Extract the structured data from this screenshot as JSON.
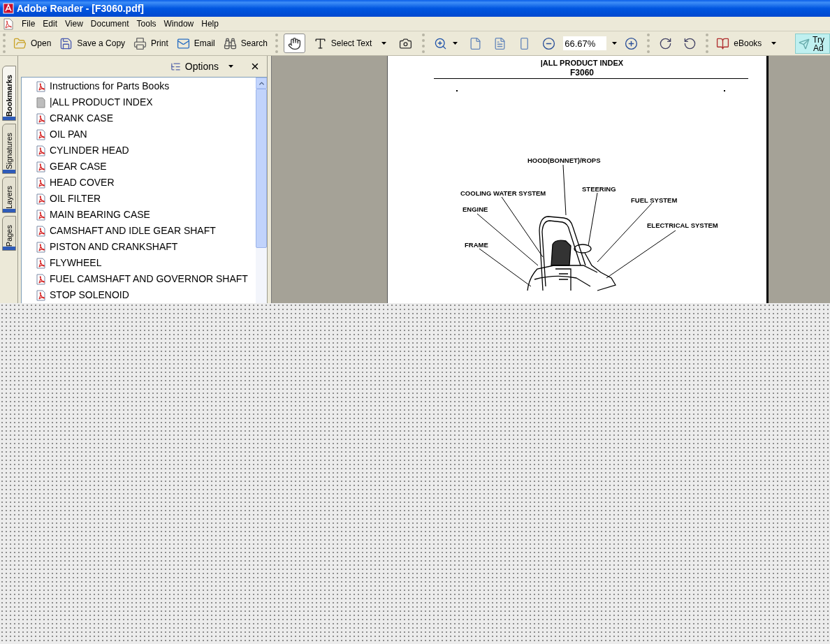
{
  "window": {
    "title": "Adobe Reader - [F3060.pdf]"
  },
  "menu": [
    "File",
    "Edit",
    "View",
    "Document",
    "Tools",
    "Window",
    "Help"
  ],
  "toolbar": {
    "groups": [
      [
        {
          "kind": "labeled",
          "label": "Open"
        },
        {
          "kind": "labeled",
          "label": "Save a Copy"
        },
        {
          "kind": "labeled",
          "label": "Print"
        },
        {
          "kind": "labeled",
          "label": "Email"
        },
        {
          "kind": "labeled",
          "label": "Search"
        }
      ],
      [
        {
          "kind": "tool",
          "selected": true
        },
        {
          "kind": "tool",
          "label": "Select Text",
          "selected": false,
          "dropdown": true
        },
        {
          "kind": "tool",
          "selected": false
        }
      ],
      [
        {
          "kind": "icon",
          "dropdown": true
        },
        {
          "kind": "icon"
        },
        {
          "kind": "icon"
        },
        {
          "kind": "icon"
        },
        {
          "kind": "icon"
        },
        {
          "kind": "field",
          "value": "66.67%",
          "dropdown": true
        },
        {
          "kind": "icon"
        }
      ],
      [
        {
          "kind": "icon"
        },
        {
          "kind": "icon"
        }
      ],
      [
        {
          "kind": "labeled",
          "label": "eBooks",
          "dropdown": true
        }
      ]
    ],
    "promo": {
      "lines": [
        "Try",
        "Ad"
      ]
    }
  },
  "sidebar": {
    "tabs": [
      {
        "label": "Bookmarks",
        "selected": true
      },
      {
        "label": "Signatures",
        "selected": false
      },
      {
        "label": "Layers",
        "selected": false
      },
      {
        "label": "Pages",
        "selected": false
      }
    ],
    "options": "Options",
    "bookmarks": [
      {
        "kind": "pdf",
        "label": "Instructions for Parts Books"
      },
      {
        "kind": "plain",
        "label": "|ALL PRODUCT INDEX"
      },
      {
        "kind": "pdf",
        "label": "CRANK CASE"
      },
      {
        "kind": "pdf",
        "label": "OIL PAN"
      },
      {
        "kind": "pdf",
        "label": "CYLINDER HEAD"
      },
      {
        "kind": "pdf",
        "label": "GEAR CASE"
      },
      {
        "kind": "pdf",
        "label": "HEAD COVER"
      },
      {
        "kind": "pdf",
        "label": "OIL FILTER"
      },
      {
        "kind": "pdf",
        "label": "MAIN BEARING CASE"
      },
      {
        "kind": "pdf",
        "label": "CAMSHAFT AND IDLE GEAR SHAFT"
      },
      {
        "kind": "pdf",
        "label": "PISTON AND CRANKSHAFT"
      },
      {
        "kind": "pdf",
        "label": "FLYWHEEL"
      },
      {
        "kind": "pdf",
        "label": "FUEL CAMSHAFT AND GOVERNOR SHAFT"
      },
      {
        "kind": "pdf",
        "label": "STOP SOLENOID"
      }
    ]
  },
  "document": {
    "title": "|ALL PRODUCT INDEX",
    "subtitle": "F3060",
    "callouts": [
      "HOOD(BONNET)/ROPS",
      "COOLING WATER SYSTEM",
      "STEERING",
      "FUEL SYSTEM",
      "ENGINE",
      "ELECTRICAL SYSTEM",
      "FRAME"
    ]
  }
}
